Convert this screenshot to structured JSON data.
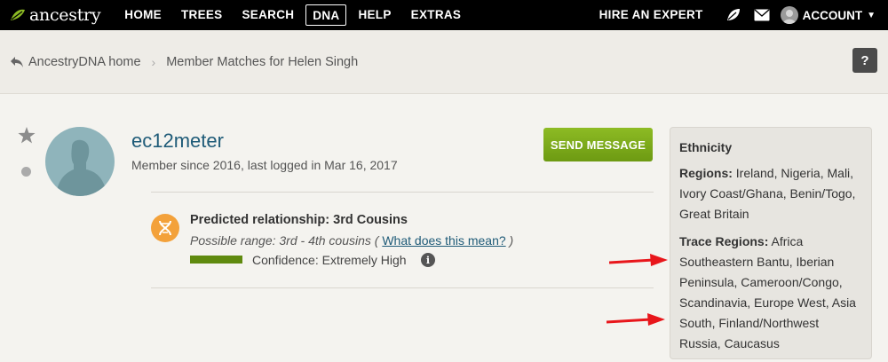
{
  "nav": {
    "logo": "ancestry",
    "items": [
      "HOME",
      "TREES",
      "SEARCH",
      "DNA",
      "HELP",
      "EXTRAS"
    ],
    "active": "DNA",
    "hire": "HIRE AN EXPERT",
    "account": "ACCOUNT"
  },
  "breadcrumb": {
    "back": "AncestryDNA home",
    "current": "Member Matches for Helen Singh"
  },
  "help_label": "?",
  "profile": {
    "username": "ec12meter",
    "member_since": "Member since 2016, last logged in Mar 16, 2017",
    "send_label": "SEND MESSAGE"
  },
  "relationship": {
    "title": "Predicted relationship: 3rd Cousins",
    "range_prefix": "Possible range: 3rd - 4th cousins (",
    "range_link": "What does this mean?",
    "range_suffix": ")",
    "confidence": "Confidence: Extremely High"
  },
  "ethnicity": {
    "title": "Ethnicity",
    "regions_label": "Regions:",
    "regions": "Ireland, Nigeria, Mali, Ivory Coast/Ghana, Benin/Togo, Great Britain",
    "trace_label": "Trace Regions:",
    "trace": "Africa Southeastern Bantu, Iberian Peninsula, Cameroon/Congo, Scandinavia, Europe West, Asia South, Finland/Northwest Russia, Caucasus"
  },
  "colors": {
    "nav_bg": "#000000",
    "link": "#1f5b78",
    "button_green": "#7aa91a",
    "confidence": "#5f8a0e",
    "dna_icon": "#f3a13a",
    "annotation": "#e8161b"
  },
  "icons": [
    "ancestry-leaf-icon",
    "leaf-icon",
    "mail-icon",
    "account-avatar-icon",
    "back-arrow-icon",
    "help-icon",
    "star-icon",
    "dot-icon",
    "dna-icon",
    "info-icon"
  ]
}
